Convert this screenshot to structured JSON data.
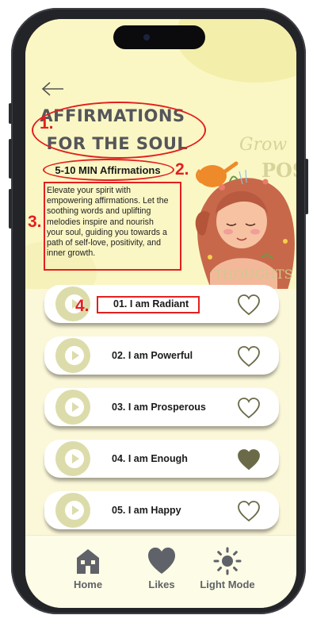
{
  "header": {
    "title_line_1": "AFFIRMATIONS",
    "title_line_2": "FOR THE SOUL",
    "subtitle": "5-10 MIN Affirmations",
    "description": "Elevate your spirit with empowering affirmations. Let the soothing words and uplifting melodies inspire and nourish your soul, guiding you towards a path of self-love, positivity, and inner growth."
  },
  "illustration": {
    "word_grow": "Grow",
    "word_positive": "POSIT",
    "word_thoughts": "THOUGHTS"
  },
  "annotations": {
    "n1": "1.",
    "n2": "2.",
    "n3": "3.",
    "n4": "4."
  },
  "affirmations": [
    {
      "label": "01. I am Radiant",
      "liked": false
    },
    {
      "label": "02. I am Powerful",
      "liked": false
    },
    {
      "label": "03. I am Prosperous",
      "liked": false
    },
    {
      "label": "04. I am Enough",
      "liked": true
    },
    {
      "label": "05. I am Happy",
      "liked": false
    }
  ],
  "tabbar": {
    "home": "Home",
    "likes": "Likes",
    "light_mode": "Light Mode"
  },
  "colors": {
    "hero_bg": "#fbf7c4",
    "play_circle": "#dcdcab",
    "heart_outline": "#6b6a48",
    "heart_filled": "#6b6a48",
    "annotation": "#e31f1f",
    "tab_icon": "#5f6268"
  },
  "icons": {
    "back": "arrow-left-icon",
    "play": "play-icon",
    "heart": "heart-icon",
    "home": "home-icon",
    "likes": "heart-icon",
    "light_mode": "sun-icon"
  }
}
